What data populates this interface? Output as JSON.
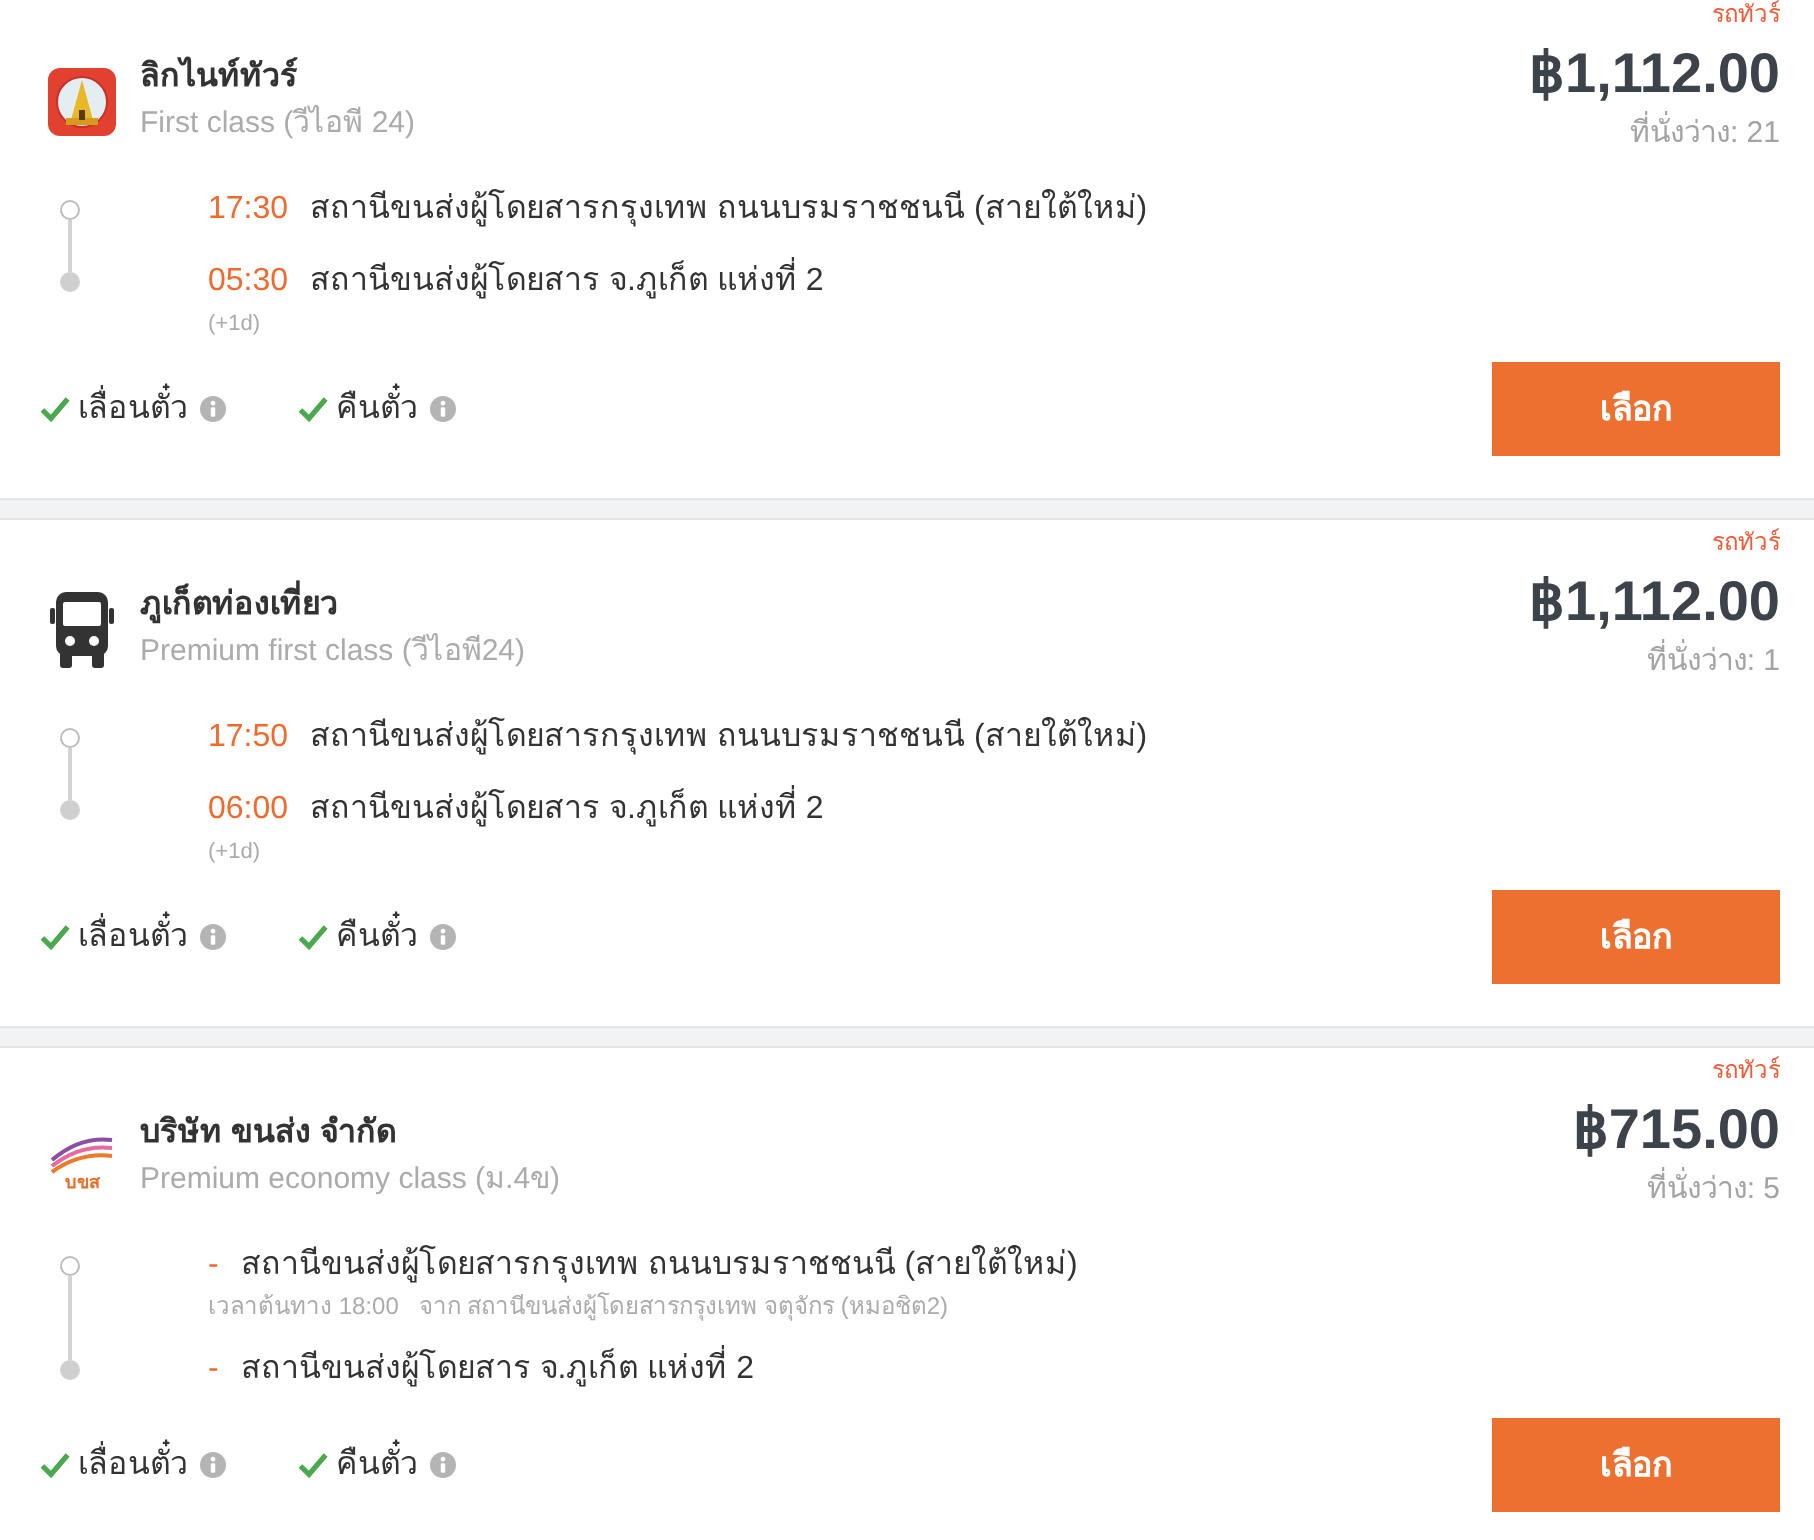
{
  "trips": [
    {
      "tag": "รถทัวร์",
      "logo": {
        "kind": "emblem"
      },
      "operator": "ลิกไนท์ทัวร์",
      "class": "First class (วีไอพี 24)",
      "price": "฿1,112.00",
      "seats": "ที่นั่งว่าง: 21",
      "stops": [
        {
          "kind": "departure",
          "time": "17:30",
          "station": "สถานีขนส่งผู้โดยสารกรุงเทพ ถนนบรมราชชนนี (สายใต้ใหม่)"
        },
        {
          "kind": "arrival",
          "time": "05:30",
          "station": "สถานีขนส่งผู้โดยสาร จ.ภูเก็ต แห่งที่ 2",
          "day_offset": "(+1d)"
        }
      ],
      "features": [
        {
          "label": "เลื่อนตั๋ว",
          "available": true
        },
        {
          "label": "คืนตั๋ว",
          "available": true
        }
      ],
      "button": "เลือก"
    },
    {
      "tag": "รถทัวร์",
      "logo": {
        "kind": "bus"
      },
      "operator": "ภูเก็ตท่องเที่ยว",
      "class": "Premium first class (วีไอพี24)",
      "price": "฿1,112.00",
      "seats": "ที่นั่งว่าง: 1",
      "stops": [
        {
          "kind": "departure",
          "time": "17:50",
          "station": "สถานีขนส่งผู้โดยสารกรุงเทพ ถนนบรมราชชนนี (สายใต้ใหม่)"
        },
        {
          "kind": "arrival",
          "time": "06:00",
          "station": "สถานีขนส่งผู้โดยสาร จ.ภูเก็ต แห่งที่ 2",
          "day_offset": "(+1d)"
        }
      ],
      "features": [
        {
          "label": "เลื่อนตั๋ว",
          "available": true
        },
        {
          "label": "คืนตั๋ว",
          "available": true
        }
      ],
      "button": "เลือก"
    },
    {
      "tag": "รถทัวร์",
      "logo": {
        "kind": "wordmark",
        "text": "บขส"
      },
      "operator": "บริษัท ขนส่ง จำกัด",
      "class": "Premium economy class (ม.4ข)",
      "price": "฿715.00",
      "seats": "ที่นั่งว่าง: 5",
      "stops": [
        {
          "kind": "departure",
          "time": "-",
          "station": "สถานีขนส่งผู้โดยสารกรุงเทพ ถนนบรมราชชนนี (สายใต้ใหม่)",
          "origin_time": "เวลาต้นทาง 18:00",
          "origin": "จาก สถานีขนส่งผู้โดยสารกรุงเทพ จตุจักร (หมอชิต2)"
        },
        {
          "kind": "arrival",
          "time": "-",
          "station": "สถานีขนส่งผู้โดยสาร จ.ภูเก็ต แห่งที่ 2"
        }
      ],
      "features": [
        {
          "label": "เลื่อนตั๋ว",
          "available": true
        },
        {
          "label": "คืนตั๋ว",
          "available": true
        }
      ],
      "button": "เลือก"
    }
  ]
}
